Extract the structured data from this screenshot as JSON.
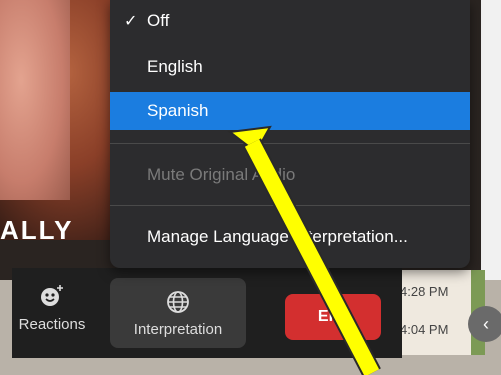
{
  "menu": {
    "items": [
      {
        "label": "Off",
        "checked": true
      },
      {
        "label": "English"
      },
      {
        "label": "Spanish",
        "selected": true
      },
      {
        "label": "Mute Original Audio",
        "disabled": true
      },
      {
        "label": "Manage Language Interpretation..."
      }
    ],
    "check": "✓"
  },
  "toolbar": {
    "reactions_label": "Reactions",
    "interpretation_label": "Interpretation",
    "end_label": "End"
  },
  "overlay": {
    "name_partial": "ALLY"
  },
  "chat": {
    "times": [
      "4:28 PM",
      "4:04 PM"
    ]
  },
  "colors": {
    "menu_bg": "#2c2c2e",
    "selected": "#1b7de0",
    "end": "#d32f2f",
    "arrow": "#ffff00"
  }
}
